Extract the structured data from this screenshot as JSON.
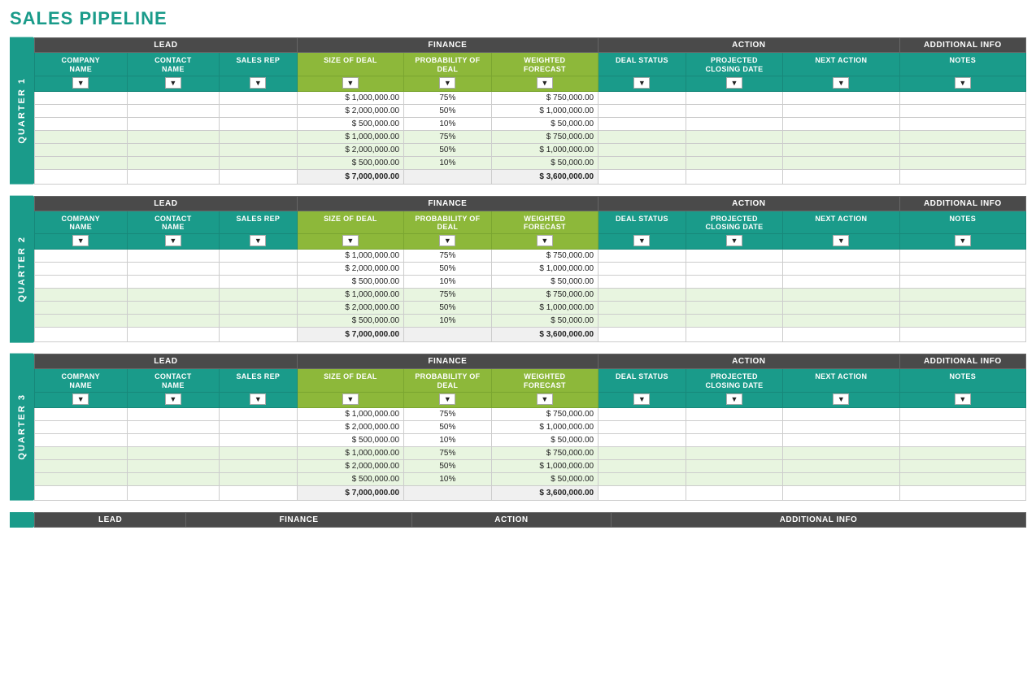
{
  "title": "SALES PIPELINE",
  "colors": {
    "teal": "#1a9b8a",
    "green": "#8db83a",
    "dark": "#4a4a4a",
    "white": "#ffffff"
  },
  "sections": {
    "lead": "LEAD",
    "finance": "FINANCE",
    "action": "ACTION",
    "additional": "ADDITIONAL INFO"
  },
  "columns": {
    "company": "COMPANY NAME",
    "contact": "CONTACT NAME",
    "salesrep": "SALES REP",
    "dealsize": "SIZE OF DEAL",
    "prob": "PROBABILITY OF DEAL",
    "weighted": "WEIGHTED FORECAST",
    "dealstatus": "DEAL STATUS",
    "projclose": "PROJECTED CLOSING DATE",
    "nextaction": "NEXT ACTION",
    "notes": "NOTES"
  },
  "quarters": [
    {
      "label": "QUARTER 1",
      "shortLabel": "QUARTER 1",
      "rows": [
        {
          "dealsize": "$ 1,000,000.00",
          "prob": "75%",
          "weighted": "$ 750,000.00",
          "alt": false
        },
        {
          "dealsize": "$ 2,000,000.00",
          "prob": "50%",
          "weighted": "$ 1,000,000.00",
          "alt": false
        },
        {
          "dealsize": "$ 500,000.00",
          "prob": "10%",
          "weighted": "$ 50,000.00",
          "alt": false
        },
        {
          "dealsize": "$ 1,000,000.00",
          "prob": "75%",
          "weighted": "$ 750,000.00",
          "alt": true
        },
        {
          "dealsize": "$ 2,000,000.00",
          "prob": "50%",
          "weighted": "$ 1,000,000.00",
          "alt": true
        },
        {
          "dealsize": "$ 500,000.00",
          "prob": "10%",
          "weighted": "$ 50,000.00",
          "alt": true
        }
      ],
      "totalDeal": "$ 7,000,000.00",
      "totalWeighted": "$ 3,600,000.00"
    },
    {
      "label": "QUARTER 2",
      "shortLabel": "QUARTER 2",
      "rows": [
        {
          "dealsize": "$ 1,000,000.00",
          "prob": "75%",
          "weighted": "$ 750,000.00",
          "alt": false
        },
        {
          "dealsize": "$ 2,000,000.00",
          "prob": "50%",
          "weighted": "$ 1,000,000.00",
          "alt": false
        },
        {
          "dealsize": "$ 500,000.00",
          "prob": "10%",
          "weighted": "$ 50,000.00",
          "alt": false
        },
        {
          "dealsize": "$ 1,000,000.00",
          "prob": "75%",
          "weighted": "$ 750,000.00",
          "alt": true
        },
        {
          "dealsize": "$ 2,000,000.00",
          "prob": "50%",
          "weighted": "$ 1,000,000.00",
          "alt": true
        },
        {
          "dealsize": "$ 500,000.00",
          "prob": "10%",
          "weighted": "$ 50,000.00",
          "alt": true
        }
      ],
      "totalDeal": "$ 7,000,000.00",
      "totalWeighted": "$ 3,600,000.00"
    },
    {
      "label": "QUARTER 3",
      "shortLabel": "QUARTER 3",
      "rows": [
        {
          "dealsize": "$ 1,000,000.00",
          "prob": "75%",
          "weighted": "$ 750,000.00",
          "alt": false
        },
        {
          "dealsize": "$ 2,000,000.00",
          "prob": "50%",
          "weighted": "$ 1,000,000.00",
          "alt": false
        },
        {
          "dealsize": "$ 500,000.00",
          "prob": "10%",
          "weighted": "$ 50,000.00",
          "alt": false
        },
        {
          "dealsize": "$ 1,000,000.00",
          "prob": "75%",
          "weighted": "$ 750,000.00",
          "alt": true
        },
        {
          "dealsize": "$ 2,000,000.00",
          "prob": "50%",
          "weighted": "$ 1,000,000.00",
          "alt": true
        },
        {
          "dealsize": "$ 500,000.00",
          "prob": "10%",
          "weighted": "$ 50,000.00",
          "alt": true
        }
      ],
      "totalDeal": "$ 7,000,000.00",
      "totalWeighted": "$ 3,600,000.00"
    }
  ],
  "bottomSectionLabel": "LEAD",
  "filter_label": "▼"
}
